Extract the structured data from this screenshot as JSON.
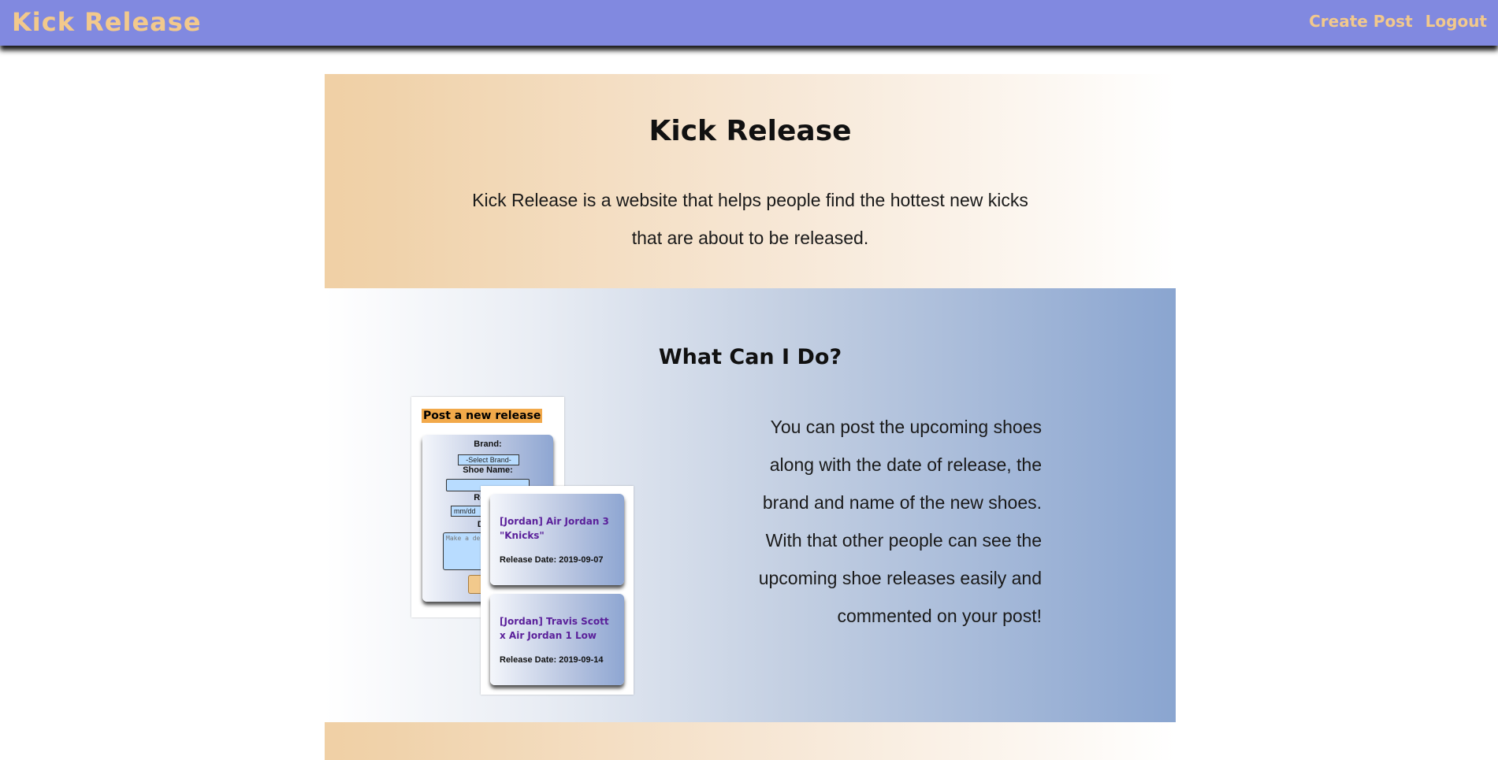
{
  "navbar": {
    "brand": "Kick Release",
    "links": [
      "Create Post",
      "Logout"
    ]
  },
  "intro": {
    "title": "Kick Release",
    "text": "Kick Release is a website that helps people find the hottest new kicks that are about to be released."
  },
  "features": {
    "title": "What Can I Do?",
    "text": "You can post the upcoming shoes along with the date of release, the brand and name of the new shoes. With that other people can see the upcoming shoe releases easily and commented on your post!",
    "form_preview": {
      "heading": "Post a new release",
      "brand_label": "Brand:",
      "brand_select": "-Select Brand-",
      "shoe_name_label": "Shoe Name:",
      "release_label": "Releas",
      "date_placeholder": "mm/dd",
      "description_label": "Desc",
      "description_placeholder": "Make a des"
    },
    "release_cards": [
      {
        "title": "[Jordan] Air Jordan 3 \"Knicks\"",
        "date": "Release Date: 2019-09-07"
      },
      {
        "title": "[Jordan] Travis Scott x Air Jordan 1 Low",
        "date": "Release Date: 2019-09-14"
      }
    ]
  },
  "colors": {
    "navbar": "#8189e0",
    "brand_text": "#f2c98c",
    "peach": "#f0d0a5",
    "blue": "#8aa5d0"
  }
}
